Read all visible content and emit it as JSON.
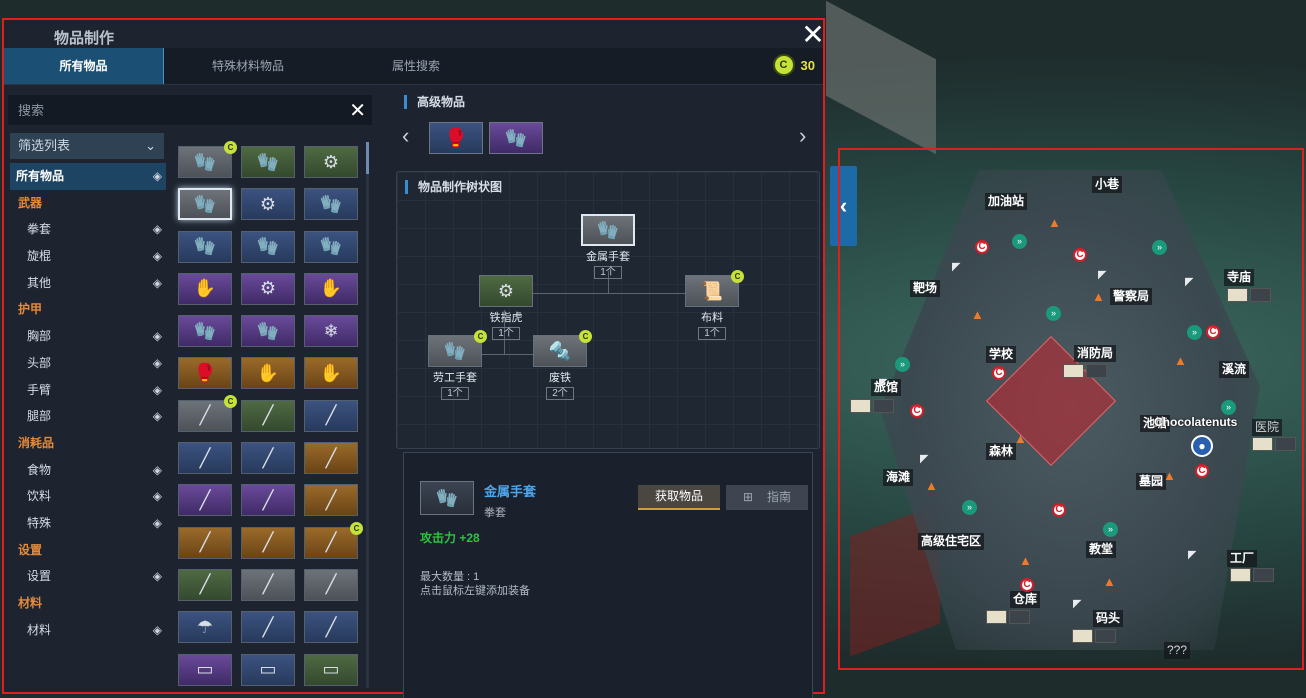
{
  "craft": {
    "title": "物品制作",
    "close": "✕",
    "tabs": [
      {
        "label": "所有物品",
        "active": true
      },
      {
        "label": "特殊材料物品",
        "active": false
      },
      {
        "label": "属性搜索",
        "active": false
      }
    ],
    "currency": {
      "icon": "c-coin-icon",
      "symbol": "C",
      "value": "30"
    },
    "search": {
      "placeholder": "搜索",
      "clear": "✕"
    },
    "filter": {
      "label": "筛选列表",
      "chevron": "⌄"
    },
    "categories": [
      {
        "label": "所有物品",
        "type": "all"
      },
      {
        "label": "武器",
        "type": "group"
      },
      {
        "label": "拳套",
        "type": "item"
      },
      {
        "label": "旋棍",
        "type": "item"
      },
      {
        "label": "其他",
        "type": "item"
      },
      {
        "label": "护甲",
        "type": "group"
      },
      {
        "label": "胸部",
        "type": "item"
      },
      {
        "label": "头部",
        "type": "item"
      },
      {
        "label": "手臂",
        "type": "item"
      },
      {
        "label": "腿部",
        "type": "item"
      },
      {
        "label": "消耗品",
        "type": "group"
      },
      {
        "label": "食物",
        "type": "item"
      },
      {
        "label": "饮料",
        "type": "item"
      },
      {
        "label": "特殊",
        "type": "item"
      },
      {
        "label": "设置",
        "type": "group"
      },
      {
        "label": "设置",
        "type": "item"
      },
      {
        "label": "材料",
        "type": "group"
      },
      {
        "label": "材料",
        "type": "item"
      }
    ],
    "grid_items": [
      {
        "icon": "work-glove-icon",
        "rarity": "gray",
        "craftable": true
      },
      {
        "icon": "leather-glove-icon",
        "rarity": "green",
        "craftable": false
      },
      {
        "icon": "brass-knuckle-icon",
        "rarity": "green",
        "craftable": false
      },
      {
        "icon": "metal-glove-icon",
        "rarity": "gray",
        "craftable": false,
        "selected": true
      },
      {
        "icon": "spiked-bracer-icon",
        "rarity": "blue",
        "craftable": false
      },
      {
        "icon": "dark-gauntlet-icon",
        "rarity": "blue",
        "craftable": false
      },
      {
        "icon": "boxing-glove-icon",
        "rarity": "blue",
        "craftable": false
      },
      {
        "icon": "steel-gauntlet-icon",
        "rarity": "blue",
        "craftable": false
      },
      {
        "icon": "red-glove-icon",
        "rarity": "blue",
        "craftable": false
      },
      {
        "icon": "gold-claw-icon",
        "rarity": "purple",
        "craftable": false
      },
      {
        "icon": "winged-knuckle-icon",
        "rarity": "purple",
        "craftable": false
      },
      {
        "icon": "beast-claw-icon",
        "rarity": "purple",
        "craftable": false
      },
      {
        "icon": "gold-gauntlet-icon",
        "rarity": "purple",
        "craftable": false
      },
      {
        "icon": "chain-gauntlet-icon",
        "rarity": "purple",
        "craftable": false
      },
      {
        "icon": "ice-crystal-icon",
        "rarity": "purple",
        "craftable": false
      },
      {
        "icon": "red-fist-icon",
        "rarity": "orange",
        "craftable": false
      },
      {
        "icon": "flame-claw-icon",
        "rarity": "orange",
        "craftable": false
      },
      {
        "icon": "dragon-claw-icon",
        "rarity": "orange",
        "craftable": false
      },
      {
        "icon": "bamboo-bundle-icon",
        "rarity": "gray",
        "craftable": true
      },
      {
        "icon": "wooden-tonfa-icon",
        "rarity": "green",
        "craftable": false
      },
      {
        "icon": "black-stick-icon",
        "rarity": "blue",
        "craftable": false
      },
      {
        "icon": "steel-tonfa-icon",
        "rarity": "blue",
        "craftable": false
      },
      {
        "icon": "twin-baton-icon",
        "rarity": "blue",
        "craftable": false
      },
      {
        "icon": "bronze-tonfa-icon",
        "rarity": "orange",
        "craftable": false
      },
      {
        "icon": "green-blade-tonfa-icon",
        "rarity": "purple",
        "craftable": false
      },
      {
        "icon": "gun-tonfa-icon",
        "rarity": "purple",
        "craftable": false
      },
      {
        "icon": "silver-tonfa-icon",
        "rarity": "orange",
        "craftable": false
      },
      {
        "icon": "purple-rod-icon",
        "rarity": "orange",
        "craftable": false
      },
      {
        "icon": "blue-device-icon",
        "rarity": "orange",
        "craftable": false
      },
      {
        "icon": "wooden-rod-icon",
        "rarity": "orange",
        "craftable": true
      },
      {
        "icon": "long-staff-icon",
        "rarity": "green",
        "craftable": false
      },
      {
        "icon": "hook-stick-icon",
        "rarity": "gray",
        "craftable": false
      },
      {
        "icon": "spiked-club-icon",
        "rarity": "gray",
        "craftable": false
      },
      {
        "icon": "umbrella-icon",
        "rarity": "blue",
        "craftable": false
      },
      {
        "icon": "fire-wand-icon",
        "rarity": "blue",
        "craftable": false
      },
      {
        "icon": "dagger-icon",
        "rarity": "blue",
        "craftable": false
      },
      {
        "icon": "partial-item-icon",
        "rarity": "purple",
        "craftable": false
      },
      {
        "icon": "partial-item-icon",
        "rarity": "blue",
        "craftable": false
      },
      {
        "icon": "partial-item-icon",
        "rarity": "green",
        "craftable": false
      }
    ],
    "advanced": {
      "title": "高级物品",
      "prev": "‹",
      "next": "›",
      "items": [
        {
          "icon": "boxing-glove-icon",
          "rarity": "blue"
        },
        {
          "icon": "chain-gauntlet-icon",
          "rarity": "purple"
        }
      ]
    },
    "tree": {
      "title": "物品制作树状图",
      "nodes": [
        {
          "id": "metal_glove",
          "name": "金属手套",
          "qty": "1个",
          "icon": "metal-glove-icon",
          "rarity": "gray",
          "craftable": false
        },
        {
          "id": "brass_knuckle",
          "name": "铁指虎",
          "qty": "1个",
          "icon": "brass-knuckle-icon",
          "rarity": "green",
          "craftable": false
        },
        {
          "id": "cloth",
          "name": "布料",
          "qty": "1个",
          "icon": "cloth-roll-icon",
          "rarity": "gray",
          "craftable": true
        },
        {
          "id": "work_glove",
          "name": "劳工手套",
          "qty": "1个",
          "icon": "work-glove-icon",
          "rarity": "gray",
          "craftable": true
        },
        {
          "id": "scrap",
          "name": "废铁",
          "qty": "2个",
          "icon": "scrap-metal-icon",
          "rarity": "gray",
          "craftable": true
        }
      ]
    },
    "detail": {
      "name": "金属手套",
      "type": "拳套",
      "stat": "攻击力 +28",
      "max_line1": "最大数量 : 1",
      "max_line2": "点击鼠标左键添加装备",
      "get_button": "获取物品",
      "guide_button": "指南",
      "icon": "metal-glove-icon"
    },
    "side_toggle": "‹"
  },
  "map": {
    "labels": [
      {
        "text": "小巷",
        "dim": false
      },
      {
        "text": "加油站",
        "dim": false
      },
      {
        "text": "寺庙",
        "dim": false
      },
      {
        "text": "靶场",
        "dim": false
      },
      {
        "text": "警察局",
        "dim": false
      },
      {
        "text": "学校",
        "dim": false
      },
      {
        "text": "消防局",
        "dim": false
      },
      {
        "text": "溪流",
        "dim": false
      },
      {
        "text": "旅馆",
        "dim": false
      },
      {
        "text": "池塘",
        "dim": false
      },
      {
        "text": "医院",
        "dim": true
      },
      {
        "text": "森林",
        "dim": false
      },
      {
        "text": "海滩",
        "dim": false
      },
      {
        "text": "墓园",
        "dim": false
      },
      {
        "text": "高级住宅区",
        "dim": false
      },
      {
        "text": "教堂",
        "dim": false
      },
      {
        "text": "工厂",
        "dim": false
      },
      {
        "text": "仓库",
        "dim": false
      },
      {
        "text": "码头",
        "dim": false
      },
      {
        "text": "???",
        "dim": true
      }
    ],
    "player_name": "Chocolatenuts",
    "restricted_zone_color": "#c0283a"
  }
}
